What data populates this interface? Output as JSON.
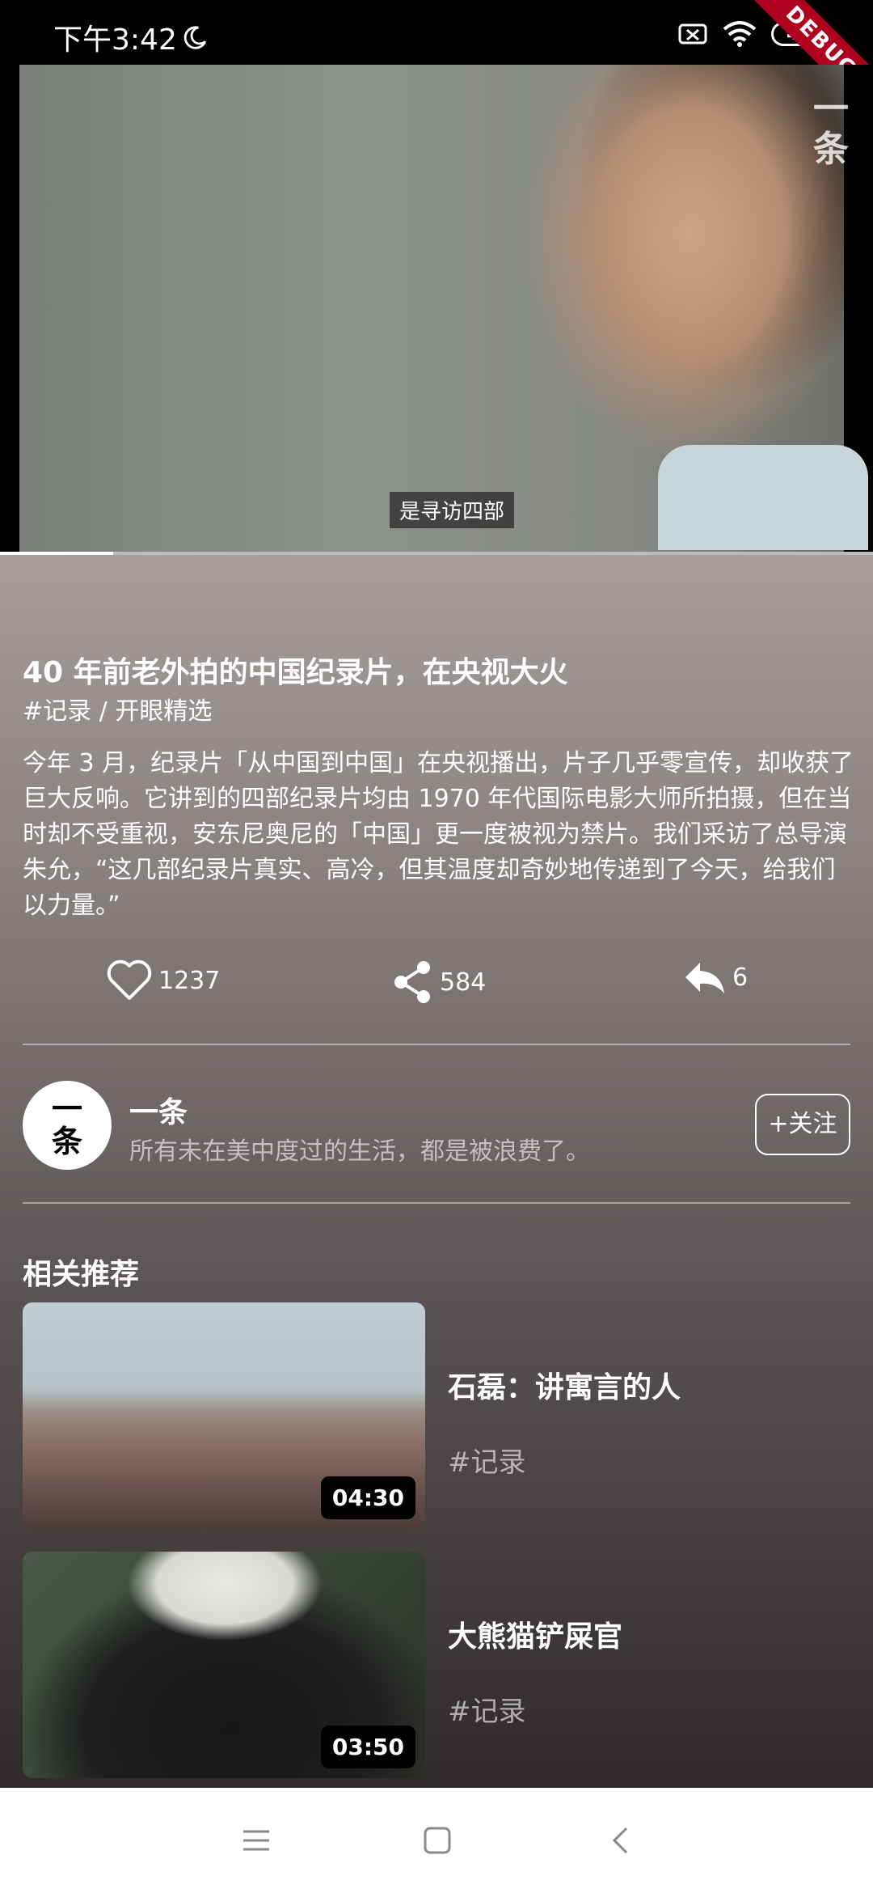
{
  "status_bar": {
    "time": "下午3:42",
    "battery": "44",
    "debug_label": "DEBUG",
    "icons": [
      "moon-icon",
      "notification-muted-icon",
      "wifi-icon",
      "battery-icon"
    ]
  },
  "video": {
    "subtitle": "是寻访四部",
    "watermark_line1": "一",
    "watermark_line2": "条",
    "progress": 0.13
  },
  "article": {
    "title": "40 年前老外拍的中国纪录片，在央视大火",
    "tags": "#记录 / 开眼精选",
    "description": "今年 3 月，纪录片「从中国到中国」在央视播出，片子几乎零宣传，却收获了巨大反响。它讲到的四部纪录片均由 1970 年代国际电影大师所拍摄，但在当时却不受重视，安东尼奥尼的「中国」更一度被视为禁片。我们采访了总导演朱允，“这几部纪录片真实、高冷，但其温度却奇妙地传递到了今天，给我们以力量。”"
  },
  "actions": {
    "likes": "1237",
    "shares": "584",
    "replies": "6"
  },
  "author": {
    "avatar_line1": "一",
    "avatar_line2": "条",
    "name": "一条",
    "bio": "所有未在美中度过的生活，都是被浪费了。",
    "follow_label": "+关注"
  },
  "related": {
    "section_title": "相关推荐",
    "items": [
      {
        "title": "石磊：讲寓言的人",
        "tag": "#记录",
        "duration": "04:30"
      },
      {
        "title": "大熊猫铲屎官",
        "tag": "#记录",
        "duration": "03:50"
      }
    ]
  },
  "colors": {
    "background_top": "#a69e9d",
    "background_bottom": "#2f2b2b",
    "debug_ribbon": "#b00020"
  }
}
